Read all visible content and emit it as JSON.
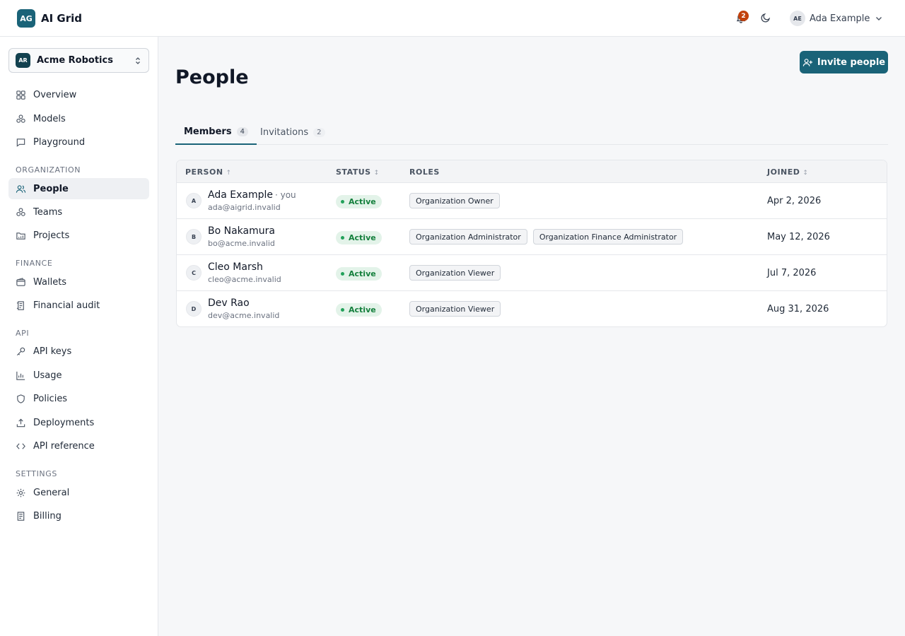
{
  "app": {
    "logo_initials": "AG",
    "name": "AI Grid"
  },
  "header": {
    "notification_count": "2",
    "user_initials": "AE",
    "user_name": "Ada Example"
  },
  "org": {
    "initials": "AR",
    "name": "Acme Robotics"
  },
  "nav": {
    "main": [
      {
        "label": "Overview",
        "icon": "grid-icon"
      },
      {
        "label": "Models",
        "icon": "models-icon"
      },
      {
        "label": "Playground",
        "icon": "chat-icon"
      }
    ],
    "organization_label": "ORGANIZATION",
    "organization": [
      {
        "label": "People",
        "icon": "users-icon",
        "active": true
      },
      {
        "label": "Teams",
        "icon": "teams-icon"
      },
      {
        "label": "Projects",
        "icon": "folder-icon"
      }
    ],
    "finance_label": "FINANCE",
    "finance": [
      {
        "label": "Wallets",
        "icon": "wallet-icon"
      },
      {
        "label": "Financial audit",
        "icon": "receipt-icon"
      }
    ],
    "api_label": "API",
    "api": [
      {
        "label": "API keys",
        "icon": "key-icon"
      },
      {
        "label": "Usage",
        "icon": "chart-icon"
      },
      {
        "label": "Policies",
        "icon": "shield-icon"
      },
      {
        "label": "Deployments",
        "icon": "upload-icon"
      },
      {
        "label": "API reference",
        "icon": "code-icon"
      }
    ],
    "settings_label": "SETTINGS",
    "settings": [
      {
        "label": "General",
        "icon": "gear-icon"
      },
      {
        "label": "Billing",
        "icon": "document-icon"
      }
    ]
  },
  "page": {
    "title": "People",
    "invite_label": "Invite people"
  },
  "tabs": [
    {
      "label": "Members",
      "count": "4",
      "active": true
    },
    {
      "label": "Invitations",
      "count": "2"
    }
  ],
  "table": {
    "headers": {
      "person": "PERSON",
      "status": "STATUS",
      "roles": "ROLES",
      "joined": "JOINED"
    },
    "sort_person": "↑",
    "sort_other": "↕",
    "rows": [
      {
        "initial": "A",
        "name": "Ada Example",
        "you": "· you",
        "email": "ada@aigrid.invalid",
        "status": "Active",
        "roles": [
          "Organization Owner"
        ],
        "joined": "Apr 2, 2026"
      },
      {
        "initial": "B",
        "name": "Bo Nakamura",
        "you": "",
        "email": "bo@acme.invalid",
        "status": "Active",
        "roles": [
          "Organization Administrator",
          "Organization Finance Administrator"
        ],
        "joined": "May 12, 2026"
      },
      {
        "initial": "C",
        "name": "Cleo Marsh",
        "you": "",
        "email": "cleo@acme.invalid",
        "status": "Active",
        "roles": [
          "Organization Viewer"
        ],
        "joined": "Jul 7, 2026"
      },
      {
        "initial": "D",
        "name": "Dev Rao",
        "you": "",
        "email": "dev@acme.invalid",
        "status": "Active",
        "roles": [
          "Organization Viewer"
        ],
        "joined": "Aug 31, 2026"
      }
    ]
  },
  "colors": {
    "accent": "#1a6378",
    "badge": "#c2410c",
    "status_bg": "#e3f3e9",
    "status_text": "#15803d"
  }
}
